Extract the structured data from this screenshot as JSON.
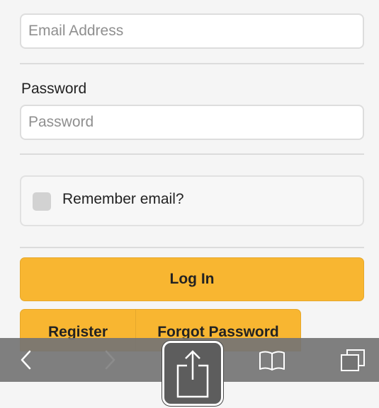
{
  "form": {
    "email": {
      "value": "",
      "placeholder": "Email Address"
    },
    "password": {
      "label": "Password",
      "value": "",
      "placeholder": "Password"
    },
    "remember": {
      "label": "Remember email?",
      "checked": false
    },
    "login_label": "Log In",
    "register_label": "Register",
    "forgot_label": "Forgot Password"
  },
  "colors": {
    "accent": "#f8b631",
    "page_background": "#f5f5f5",
    "toolbar": "#747474"
  },
  "toolbar": {
    "icons": [
      "back-icon",
      "forward-icon",
      "share-icon",
      "bookmarks-icon",
      "tabs-icon"
    ],
    "forward_enabled": false
  }
}
